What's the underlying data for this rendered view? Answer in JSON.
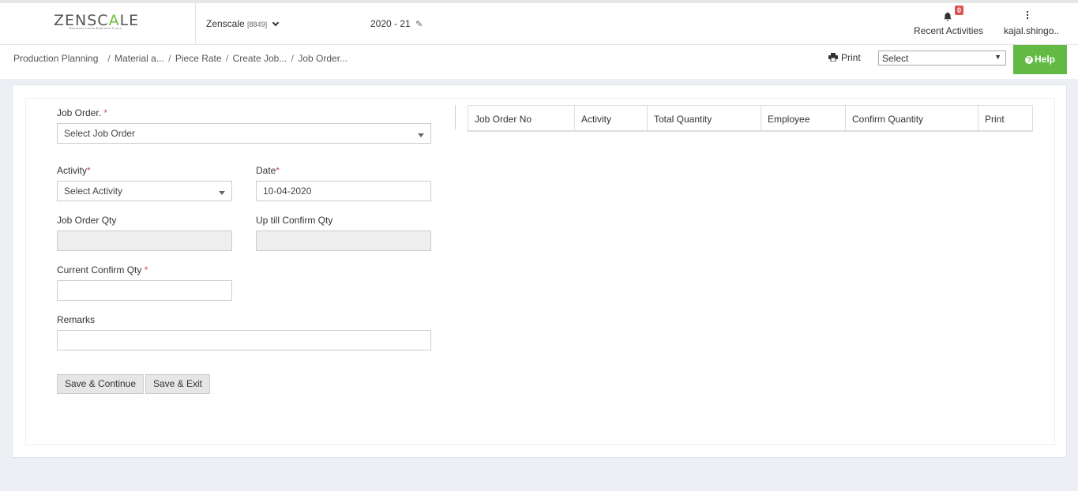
{
  "header": {
    "logo_text_a": "ZENSC",
    "logo_text_b": "A",
    "logo_text_c": "LE",
    "logo_tagline": "Business Looks Business Focus",
    "company_name": "Zenscale",
    "company_code": "[8849]",
    "financial_year": "2020 - 21",
    "notification_count": "0",
    "recent_activities_label": "Recent Activities",
    "user_name": "kajal.shingo..",
    "colors": {
      "brand_green": "#62b944",
      "badge_red": "#d9534f"
    }
  },
  "breadcrumb": {
    "items": [
      "Production Planning",
      "Material a...",
      "Piece Rate",
      "Create Job...",
      "Job Order..."
    ]
  },
  "toolbar": {
    "print_label": "Print",
    "select_value": "Select",
    "help_label": "Help"
  },
  "form": {
    "job_order_label": "Job Order.",
    "job_order_placeholder": "Select Job Order",
    "activity_label": "Activity",
    "activity_placeholder": "Select Activity",
    "date_label": "Date",
    "date_value": "10-04-2020",
    "job_order_qty_label": "Job Order Qty",
    "up_till_confirm_qty_label": "Up till Confirm Qty",
    "current_confirm_qty_label": "Current Confirm Qty",
    "remarks_label": "Remarks",
    "required_mark": "*",
    "save_continue_label": "Save & Continue",
    "save_exit_label": "Save & Exit"
  },
  "table": {
    "columns": [
      "Job Order No",
      "Activity",
      "Total Quantity",
      "Employee",
      "Confirm Quantity",
      "Print"
    ]
  }
}
